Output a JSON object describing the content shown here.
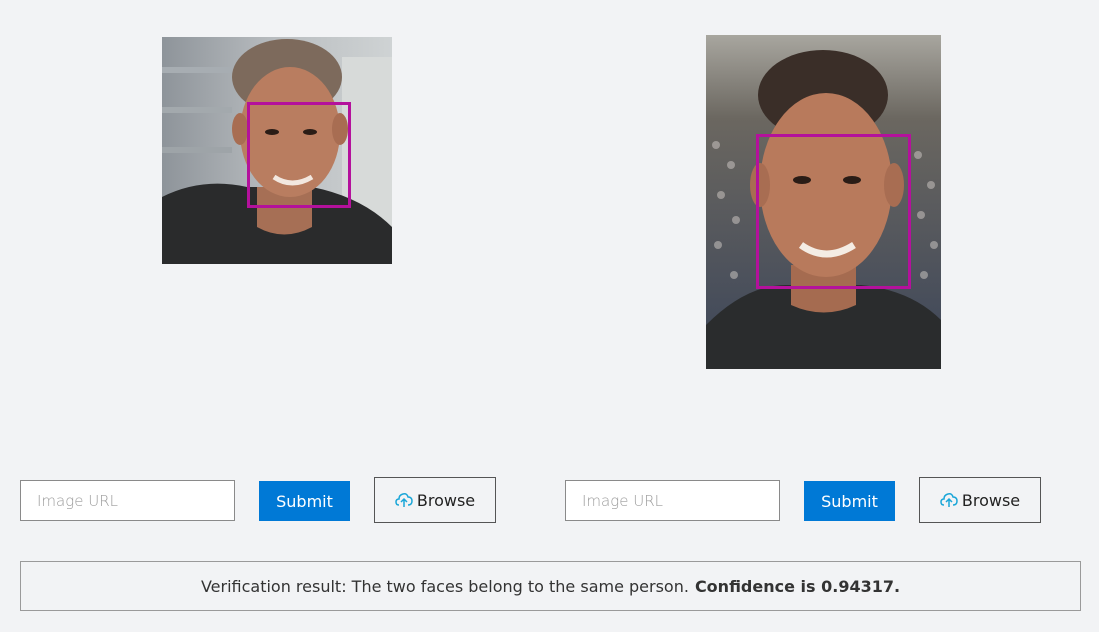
{
  "left_panel": {
    "image_alt": "Face image 1",
    "url_placeholder": "Image URL",
    "submit_label": "Submit",
    "browse_label": "Browse"
  },
  "right_panel": {
    "image_alt": "Face image 2",
    "url_placeholder": "Image URL",
    "submit_label": "Submit",
    "browse_label": "Browse"
  },
  "result": {
    "text": "Verification result: The two faces belong to the same person.",
    "confidence_text": "Confidence is 0.94317."
  },
  "colors": {
    "face_box": "#b4119c",
    "submit_bg": "#0079d6",
    "browse_icon": "#1aa6d8"
  },
  "icons": {
    "browse": "cloud-upload-icon"
  }
}
